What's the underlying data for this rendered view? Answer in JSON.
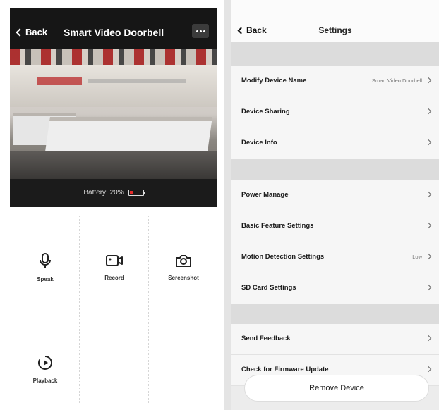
{
  "left": {
    "back_label": "Back",
    "title": "Smart  Video Doorbell",
    "battery_text": "Battery: 20%",
    "battery_level_fraction": 0.2,
    "battery_color": "#e52b2b",
    "controls": [
      {
        "label": "Speak",
        "icon": "microphone-icon"
      },
      {
        "label": "Record",
        "icon": "video-camera-icon"
      },
      {
        "label": "Screenshot",
        "icon": "camera-icon"
      },
      {
        "label": "Playback",
        "icon": "playback-icon"
      }
    ]
  },
  "right": {
    "back_label": "Back",
    "title": "Settings",
    "items": [
      {
        "label": "Modify Device Name",
        "value": "Smart  Video Doorbell"
      },
      {
        "label": "Device Sharing",
        "value": ""
      },
      {
        "label": "Device Info",
        "value": ""
      },
      {
        "label": "Power Manage",
        "value": ""
      },
      {
        "label": "Basic Feature Settings",
        "value": ""
      },
      {
        "label": "Motion Detection Settings",
        "value": "Low"
      },
      {
        "label": "SD Card Settings",
        "value": ""
      },
      {
        "label": "Send Feedback",
        "value": ""
      },
      {
        "label": "Check for Firmware Update",
        "value": ""
      }
    ],
    "remove_label": "Remove Device"
  }
}
